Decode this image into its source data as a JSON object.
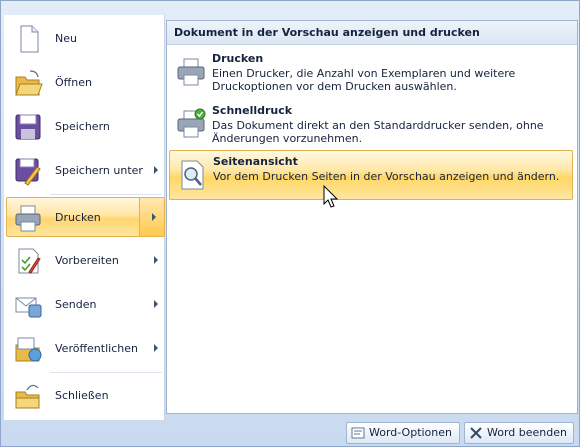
{
  "left_menu": {
    "items": [
      {
        "label": "Neu",
        "icon": "new-document-icon"
      },
      {
        "label": "Öffnen",
        "icon": "open-folder-icon"
      },
      {
        "label": "Speichern",
        "icon": "save-icon"
      },
      {
        "label": "Speichern unter",
        "icon": "save-as-icon",
        "has_submenu": true
      },
      {
        "label": "Drucken",
        "icon": "printer-icon",
        "has_submenu": true,
        "selected": true
      },
      {
        "label": "Vorbereiten",
        "icon": "prepare-icon",
        "has_submenu": true
      },
      {
        "label": "Senden",
        "icon": "send-icon",
        "has_submenu": true
      },
      {
        "label": "Veröffentlichen",
        "icon": "publish-icon",
        "has_submenu": true
      },
      {
        "label": "Schließen",
        "icon": "close-folder-icon"
      }
    ]
  },
  "submenu": {
    "header": "Dokument in der Vorschau anzeigen und drucken",
    "items": [
      {
        "title": "Drucken",
        "description": "Einen Drucker, die Anzahl von Exemplaren und weitere Druckoptionen vor dem Drucken auswählen.",
        "icon": "printer-icon"
      },
      {
        "title": "Schnelldruck",
        "description": "Das Dokument direkt an den Standarddrucker senden, ohne Änderungen vorzunehmen.",
        "icon": "quick-print-icon"
      },
      {
        "title": "Seitenansicht",
        "description": "Vor dem Drucken Seiten in der Vorschau anzeigen und ändern.",
        "icon": "print-preview-icon",
        "hovered": true
      }
    ]
  },
  "footer": {
    "options_label": "Word-Optionen",
    "exit_label": "Word beenden"
  },
  "colors": {
    "highlight": "#ffd766",
    "highlight_border": "#e4b04d",
    "frame": "#d4e2f3"
  }
}
